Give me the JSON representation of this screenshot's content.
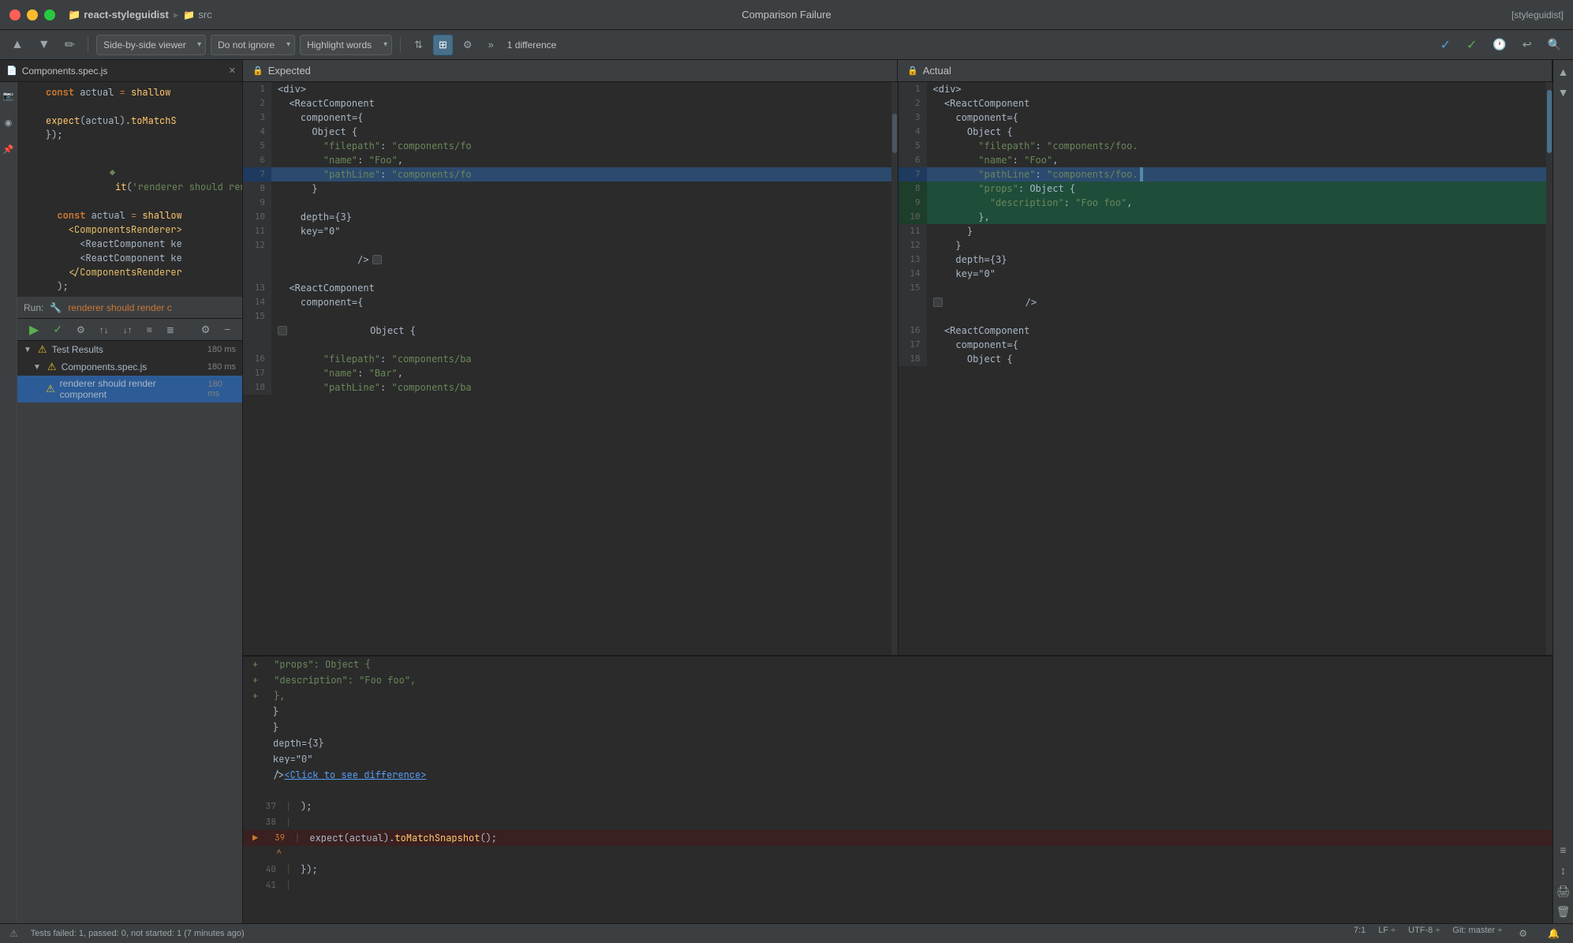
{
  "titlebar": {
    "title": "Comparison Failure",
    "project": "react-styleguidist",
    "src": "src",
    "right_label": "[styleguidist]"
  },
  "toolbar": {
    "viewer_label": "Side-by-side viewer",
    "ignore_label": "Do not ignore",
    "highlight_label": "Highlight words",
    "diff_count": "1 difference",
    "up_arrow": "▲",
    "down_arrow": "▼"
  },
  "diff_panels": {
    "expected_label": "Expected",
    "actual_label": "Actual"
  },
  "expected_lines": [
    {
      "num": "1",
      "content": "<div>",
      "type": "normal"
    },
    {
      "num": "2",
      "content": "  <ReactComponent",
      "type": "normal"
    },
    {
      "num": "3",
      "content": "    component={",
      "type": "normal"
    },
    {
      "num": "4",
      "content": "      Object {",
      "type": "normal"
    },
    {
      "num": "5",
      "content": "        \"filepath\": \"components/fo",
      "type": "normal"
    },
    {
      "num": "6",
      "content": "        \"name\": \"Foo\",",
      "type": "normal"
    },
    {
      "num": "7",
      "content": "        \"pathLine\": \"components/fo",
      "type": "highlight"
    },
    {
      "num": "8",
      "content": "      }",
      "type": "normal"
    },
    {
      "num": "9",
      "content": "",
      "type": "normal"
    },
    {
      "num": "10",
      "content": "    depth={3}",
      "type": "normal"
    },
    {
      "num": "11",
      "content": "    key=\"0\"",
      "type": "normal"
    },
    {
      "num": "12",
      "content": "  />",
      "type": "normal"
    },
    {
      "num": "13",
      "content": "  <ReactComponent",
      "type": "normal"
    },
    {
      "num": "14",
      "content": "    component={",
      "type": "normal"
    },
    {
      "num": "15",
      "content": "      Object {",
      "type": "normal"
    },
    {
      "num": "16",
      "content": "        \"filepath\": \"components/ba",
      "type": "normal"
    },
    {
      "num": "17",
      "content": "        \"name\": \"Bar\",",
      "type": "normal"
    },
    {
      "num": "18",
      "content": "        \"pathLine\": \"components/ba",
      "type": "normal"
    }
  ],
  "actual_lines": [
    {
      "num": "1",
      "content": "<div>",
      "type": "normal"
    },
    {
      "num": "2",
      "content": "  <ReactComponent",
      "type": "normal"
    },
    {
      "num": "3",
      "content": "    component={",
      "type": "normal"
    },
    {
      "num": "4",
      "content": "      Object {",
      "type": "normal"
    },
    {
      "num": "5",
      "content": "        \"filepath\": \"components/foo.",
      "type": "normal"
    },
    {
      "num": "6",
      "content": "        \"name\": \"Foo\",",
      "type": "normal"
    },
    {
      "num": "7",
      "content": "        \"pathLine\": \"components/foo.",
      "type": "highlight"
    },
    {
      "num": "8",
      "content": "        \"props\": Object {",
      "type": "added"
    },
    {
      "num": "9",
      "content": "          \"description\": \"Foo foo\",",
      "type": "added"
    },
    {
      "num": "10",
      "content": "        },",
      "type": "added"
    },
    {
      "num": "11",
      "content": "      }",
      "type": "normal"
    },
    {
      "num": "12",
      "content": "    }",
      "type": "normal"
    },
    {
      "num": "13",
      "content": "    depth={3}",
      "type": "normal"
    },
    {
      "num": "14",
      "content": "    key=\"0\"",
      "type": "normal"
    },
    {
      "num": "15",
      "content": "  />",
      "type": "normal"
    },
    {
      "num": "16",
      "content": "  <ReactComponent",
      "type": "normal"
    },
    {
      "num": "17",
      "content": "    component={",
      "type": "normal"
    },
    {
      "num": "18",
      "content": "      Object {",
      "type": "normal"
    }
  ],
  "bottom_code": {
    "lines": [
      {
        "num": "",
        "content": "  +         \"props\": Object {",
        "type": "added"
      },
      {
        "num": "",
        "content": "  +           \"description\": \"Foo foo\",",
        "type": "added"
      },
      {
        "num": "",
        "content": "  +         },",
        "type": "added"
      },
      {
        "num": "",
        "content": "          }",
        "type": "normal"
      },
      {
        "num": "",
        "content": "        }",
        "type": "normal"
      },
      {
        "num": "",
        "content": "        depth={3}",
        "type": "normal"
      },
      {
        "num": "",
        "content": "        key=\"0\"",
        "type": "normal"
      },
      {
        "num": "",
        "content": "      /> <Click to see difference>",
        "type": "link"
      },
      {
        "num": "",
        "content": "",
        "type": "empty"
      },
      {
        "num": "37",
        "content": "      );",
        "type": "normal"
      },
      {
        "num": "38",
        "content": "",
        "type": "empty"
      },
      {
        "num": "39",
        "content": "      expect(actual).toMatchSnapshot();",
        "type": "error"
      },
      {
        "num": "",
        "content": "                 ^",
        "type": "error_marker"
      },
      {
        "num": "40",
        "content": "    });",
        "type": "normal"
      },
      {
        "num": "41",
        "content": "",
        "type": "empty"
      }
    ]
  },
  "sidebar_code": {
    "lines": [
      {
        "content": "  const actual = shallow"
      },
      {
        "content": ""
      },
      {
        "content": "  expect(actual).toMatchS"
      },
      {
        "content": "});"
      }
    ]
  },
  "test_results": {
    "label": "Test Results",
    "file": "Components.spec.js",
    "test_name": "renderer should render component",
    "times": [
      "180 ms",
      "180 ms",
      "180 ms"
    ]
  },
  "run": {
    "label": "Run:",
    "test": "renderer should render c"
  },
  "statusbar": {
    "status": "Tests failed: 1, passed: 0, not started: 1 (7 minutes ago)",
    "position": "7:1",
    "line_ending": "LF ÷",
    "encoding": "UTF-8 ÷",
    "git": "Git: master ÷"
  }
}
